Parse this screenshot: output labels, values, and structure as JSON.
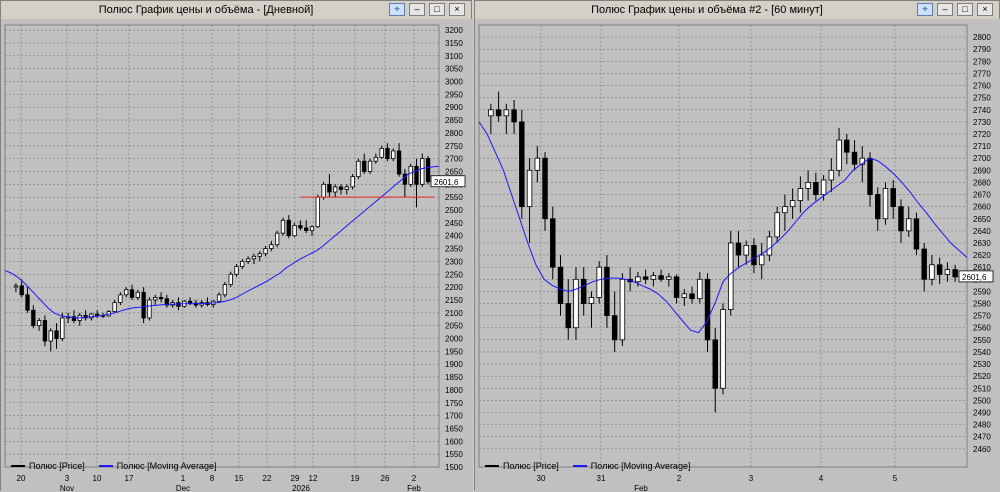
{
  "windows": [
    {
      "title": "Полюс График цены и объёма - [Дневной]",
      "legend": [
        {
          "label": "Полюс [Price]",
          "color": "#000000"
        },
        {
          "label": "Полюс [Moving Average]",
          "color": "#1a1aff"
        }
      ],
      "price_label": "2601,6"
    },
    {
      "title": "Полюс График цены и объёма #2 - [60 минут]",
      "legend": [
        {
          "label": "Полюс [Price]",
          "color": "#000000"
        },
        {
          "label": "Полюс [Moving Average]",
          "color": "#1a1aff"
        }
      ],
      "price_label": "2601,6"
    }
  ],
  "chart_data": [
    {
      "type": "candlestick",
      "title": "Полюс График цены и объёма - [Дневной]",
      "ylim": [
        1500,
        3220
      ],
      "y_ticks": [
        1500,
        1550,
        1600,
        1650,
        1700,
        1750,
        1800,
        1850,
        1900,
        1950,
        2000,
        2050,
        2100,
        2150,
        2200,
        2250,
        2300,
        2350,
        2400,
        2450,
        2500,
        2550,
        2600,
        2650,
        2700,
        2750,
        2800,
        2850,
        2900,
        2950,
        3000,
        3050,
        3100,
        3150,
        3200
      ],
      "x_day_labels": [
        "20",
        "3",
        "10",
        "17",
        "1",
        "8",
        "15",
        "22",
        "29",
        "12",
        "19",
        "26",
        "2"
      ],
      "x_month_labels": [
        "Nov",
        "Dec",
        "2026",
        "Feb"
      ],
      "candles": [
        {
          "o": 2200,
          "h": 2215,
          "l": 2180,
          "c": 2205
        },
        {
          "o": 2205,
          "h": 2230,
          "l": 2160,
          "c": 2170
        },
        {
          "o": 2170,
          "h": 2200,
          "l": 2100,
          "c": 2110
        },
        {
          "o": 2110,
          "h": 2130,
          "l": 2040,
          "c": 2050
        },
        {
          "o": 2050,
          "h": 2080,
          "l": 2030,
          "c": 2070
        },
        {
          "o": 2070,
          "h": 2090,
          "l": 1970,
          "c": 1990
        },
        {
          "o": 1990,
          "h": 2040,
          "l": 1950,
          "c": 2030
        },
        {
          "o": 2030,
          "h": 2060,
          "l": 1960,
          "c": 2000
        },
        {
          "o": 2000,
          "h": 2100,
          "l": 1990,
          "c": 2080
        },
        {
          "o": 2080,
          "h": 2100,
          "l": 2060,
          "c": 2085
        },
        {
          "o": 2085,
          "h": 2110,
          "l": 2060,
          "c": 2070
        },
        {
          "o": 2070,
          "h": 2100,
          "l": 2050,
          "c": 2090
        },
        {
          "o": 2090,
          "h": 2110,
          "l": 2070,
          "c": 2080
        },
        {
          "o": 2080,
          "h": 2100,
          "l": 2070,
          "c": 2095
        },
        {
          "o": 2095,
          "h": 2110,
          "l": 2080,
          "c": 2090
        },
        {
          "o": 2090,
          "h": 2100,
          "l": 2080,
          "c": 2088
        },
        {
          "o": 2088,
          "h": 2110,
          "l": 2085,
          "c": 2105
        },
        {
          "o": 2105,
          "h": 2150,
          "l": 2100,
          "c": 2140
        },
        {
          "o": 2140,
          "h": 2180,
          "l": 2130,
          "c": 2170
        },
        {
          "o": 2170,
          "h": 2200,
          "l": 2160,
          "c": 2190
        },
        {
          "o": 2190,
          "h": 2210,
          "l": 2150,
          "c": 2160
        },
        {
          "o": 2160,
          "h": 2190,
          "l": 2150,
          "c": 2180
        },
        {
          "o": 2180,
          "h": 2200,
          "l": 2060,
          "c": 2080
        },
        {
          "o": 2080,
          "h": 2160,
          "l": 2070,
          "c": 2150
        },
        {
          "o": 2150,
          "h": 2170,
          "l": 2130,
          "c": 2160
        },
        {
          "o": 2160,
          "h": 2180,
          "l": 2140,
          "c": 2155
        },
        {
          "o": 2155,
          "h": 2170,
          "l": 2120,
          "c": 2130
        },
        {
          "o": 2130,
          "h": 2150,
          "l": 2120,
          "c": 2140
        },
        {
          "o": 2140,
          "h": 2160,
          "l": 2110,
          "c": 2125
        },
        {
          "o": 2125,
          "h": 2150,
          "l": 2120,
          "c": 2145
        },
        {
          "o": 2145,
          "h": 2160,
          "l": 2130,
          "c": 2138
        },
        {
          "o": 2138,
          "h": 2150,
          "l": 2120,
          "c": 2130
        },
        {
          "o": 2130,
          "h": 2150,
          "l": 2120,
          "c": 2140
        },
        {
          "o": 2140,
          "h": 2160,
          "l": 2125,
          "c": 2132
        },
        {
          "o": 2132,
          "h": 2150,
          "l": 2120,
          "c": 2145
        },
        {
          "o": 2145,
          "h": 2180,
          "l": 2140,
          "c": 2170
        },
        {
          "o": 2170,
          "h": 2220,
          "l": 2160,
          "c": 2210
        },
        {
          "o": 2210,
          "h": 2260,
          "l": 2200,
          "c": 2250
        },
        {
          "o": 2250,
          "h": 2290,
          "l": 2240,
          "c": 2280
        },
        {
          "o": 2280,
          "h": 2310,
          "l": 2270,
          "c": 2300
        },
        {
          "o": 2300,
          "h": 2320,
          "l": 2290,
          "c": 2310
        },
        {
          "o": 2310,
          "h": 2330,
          "l": 2290,
          "c": 2320
        },
        {
          "o": 2320,
          "h": 2340,
          "l": 2300,
          "c": 2330
        },
        {
          "o": 2330,
          "h": 2360,
          "l": 2320,
          "c": 2350
        },
        {
          "o": 2350,
          "h": 2380,
          "l": 2340,
          "c": 2365
        },
        {
          "o": 2365,
          "h": 2420,
          "l": 2355,
          "c": 2410
        },
        {
          "o": 2410,
          "h": 2470,
          "l": 2400,
          "c": 2460
        },
        {
          "o": 2460,
          "h": 2480,
          "l": 2390,
          "c": 2400
        },
        {
          "o": 2400,
          "h": 2450,
          "l": 2395,
          "c": 2440
        },
        {
          "o": 2440,
          "h": 2460,
          "l": 2420,
          "c": 2430
        },
        {
          "o": 2430,
          "h": 2460,
          "l": 2410,
          "c": 2420
        },
        {
          "o": 2420,
          "h": 2440,
          "l": 2400,
          "c": 2435
        },
        {
          "o": 2435,
          "h": 2560,
          "l": 2430,
          "c": 2550
        },
        {
          "o": 2550,
          "h": 2610,
          "l": 2540,
          "c": 2600
        },
        {
          "o": 2600,
          "h": 2640,
          "l": 2550,
          "c": 2570
        },
        {
          "o": 2570,
          "h": 2600,
          "l": 2550,
          "c": 2590
        },
        {
          "o": 2590,
          "h": 2600,
          "l": 2560,
          "c": 2580
        },
        {
          "o": 2580,
          "h": 2600,
          "l": 2560,
          "c": 2590
        },
        {
          "o": 2590,
          "h": 2640,
          "l": 2580,
          "c": 2630
        },
        {
          "o": 2630,
          "h": 2700,
          "l": 2620,
          "c": 2690
        },
        {
          "o": 2690,
          "h": 2720,
          "l": 2640,
          "c": 2650
        },
        {
          "o": 2650,
          "h": 2700,
          "l": 2640,
          "c": 2690
        },
        {
          "o": 2690,
          "h": 2720,
          "l": 2680,
          "c": 2705
        },
        {
          "o": 2705,
          "h": 2750,
          "l": 2700,
          "c": 2740
        },
        {
          "o": 2740,
          "h": 2760,
          "l": 2690,
          "c": 2700
        },
        {
          "o": 2700,
          "h": 2740,
          "l": 2690,
          "c": 2730
        },
        {
          "o": 2730,
          "h": 2760,
          "l": 2630,
          "c": 2640
        },
        {
          "o": 2640,
          "h": 2660,
          "l": 2550,
          "c": 2600
        },
        {
          "o": 2600,
          "h": 2680,
          "l": 2590,
          "c": 2670
        },
        {
          "o": 2670,
          "h": 2700,
          "l": 2510,
          "c": 2600
        },
        {
          "o": 2600,
          "h": 2720,
          "l": 2590,
          "c": 2700
        },
        {
          "o": 2700,
          "h": 2710,
          "l": 2600,
          "c": 2610
        }
      ],
      "moving_average": [
        2265,
        2255,
        2240,
        2220,
        2195,
        2170,
        2145,
        2120,
        2100,
        2090,
        2085,
        2082,
        2080,
        2082,
        2085,
        2087,
        2090,
        2095,
        2100,
        2108,
        2115,
        2120,
        2122,
        2125,
        2128,
        2130,
        2132,
        2133,
        2134,
        2135,
        2135,
        2136,
        2136,
        2137,
        2138,
        2140,
        2145,
        2152,
        2162,
        2175,
        2188,
        2200,
        2212,
        2225,
        2240,
        2255,
        2275,
        2290,
        2305,
        2318,
        2330,
        2342,
        2360,
        2380,
        2400,
        2420,
        2440,
        2460,
        2480,
        2500,
        2520,
        2540,
        2560,
        2580,
        2600,
        2620,
        2640,
        2650,
        2660,
        2665,
        2668,
        2670
      ],
      "hline": {
        "value": 2550,
        "color": "#e02020",
        "from_index": 49,
        "to_index": 71
      }
    },
    {
      "type": "candlestick",
      "title": "Полюс График цены и объёма #2 - [60 минут]",
      "ylim": [
        2445,
        2810
      ],
      "y_ticks": [
        2460,
        2470,
        2480,
        2490,
        2500,
        2510,
        2520,
        2530,
        2540,
        2550,
        2560,
        2570,
        2580,
        2590,
        2600,
        2610,
        2620,
        2630,
        2640,
        2650,
        2660,
        2670,
        2680,
        2690,
        2700,
        2710,
        2720,
        2730,
        2740,
        2750,
        2760,
        2770,
        2780,
        2790,
        2800
      ],
      "x_day_labels": [
        "30",
        "31",
        "2",
        "3",
        "4",
        "5"
      ],
      "x_month_labels": [
        "Feb"
      ],
      "candles": [
        {
          "o": 2735,
          "h": 2745,
          "l": 2720,
          "c": 2740
        },
        {
          "o": 2740,
          "h": 2755,
          "l": 2730,
          "c": 2735
        },
        {
          "o": 2735,
          "h": 2745,
          "l": 2720,
          "c": 2740
        },
        {
          "o": 2740,
          "h": 2748,
          "l": 2720,
          "c": 2730
        },
        {
          "o": 2730,
          "h": 2740,
          "l": 2650,
          "c": 2660
        },
        {
          "o": 2660,
          "h": 2700,
          "l": 2630,
          "c": 2690
        },
        {
          "o": 2690,
          "h": 2710,
          "l": 2680,
          "c": 2700
        },
        {
          "o": 2700,
          "h": 2705,
          "l": 2640,
          "c": 2650
        },
        {
          "o": 2650,
          "h": 2660,
          "l": 2600,
          "c": 2610
        },
        {
          "o": 2610,
          "h": 2620,
          "l": 2570,
          "c": 2580
        },
        {
          "o": 2580,
          "h": 2600,
          "l": 2550,
          "c": 2560
        },
        {
          "o": 2560,
          "h": 2610,
          "l": 2550,
          "c": 2600
        },
        {
          "o": 2600,
          "h": 2610,
          "l": 2570,
          "c": 2580
        },
        {
          "o": 2580,
          "h": 2590,
          "l": 2560,
          "c": 2585
        },
        {
          "o": 2585,
          "h": 2615,
          "l": 2580,
          "c": 2610
        },
        {
          "o": 2610,
          "h": 2620,
          "l": 2560,
          "c": 2570
        },
        {
          "o": 2570,
          "h": 2590,
          "l": 2540,
          "c": 2550
        },
        {
          "o": 2550,
          "h": 2605,
          "l": 2545,
          "c": 2600
        },
        {
          "o": 2600,
          "h": 2610,
          "l": 2590,
          "c": 2598
        },
        {
          "o": 2598,
          "h": 2606,
          "l": 2594,
          "c": 2602
        },
        {
          "o": 2602,
          "h": 2608,
          "l": 2596,
          "c": 2600
        },
        {
          "o": 2600,
          "h": 2606,
          "l": 2594,
          "c": 2603
        },
        {
          "o": 2603,
          "h": 2608,
          "l": 2598,
          "c": 2600
        },
        {
          "o": 2600,
          "h": 2605,
          "l": 2594,
          "c": 2602
        },
        {
          "o": 2602,
          "h": 2604,
          "l": 2580,
          "c": 2585
        },
        {
          "o": 2585,
          "h": 2592,
          "l": 2578,
          "c": 2588
        },
        {
          "o": 2588,
          "h": 2594,
          "l": 2580,
          "c": 2584
        },
        {
          "o": 2584,
          "h": 2606,
          "l": 2580,
          "c": 2600
        },
        {
          "o": 2600,
          "h": 2605,
          "l": 2540,
          "c": 2550
        },
        {
          "o": 2550,
          "h": 2560,
          "l": 2490,
          "c": 2510
        },
        {
          "o": 2510,
          "h": 2580,
          "l": 2505,
          "c": 2575
        },
        {
          "o": 2575,
          "h": 2640,
          "l": 2570,
          "c": 2630
        },
        {
          "o": 2630,
          "h": 2640,
          "l": 2610,
          "c": 2620
        },
        {
          "o": 2620,
          "h": 2632,
          "l": 2612,
          "c": 2628
        },
        {
          "o": 2628,
          "h": 2634,
          "l": 2605,
          "c": 2612
        },
        {
          "o": 2612,
          "h": 2630,
          "l": 2600,
          "c": 2620
        },
        {
          "o": 2620,
          "h": 2640,
          "l": 2615,
          "c": 2635
        },
        {
          "o": 2635,
          "h": 2660,
          "l": 2630,
          "c": 2655
        },
        {
          "o": 2655,
          "h": 2670,
          "l": 2640,
          "c": 2660
        },
        {
          "o": 2660,
          "h": 2675,
          "l": 2650,
          "c": 2665
        },
        {
          "o": 2665,
          "h": 2685,
          "l": 2655,
          "c": 2675
        },
        {
          "o": 2675,
          "h": 2690,
          "l": 2665,
          "c": 2680
        },
        {
          "o": 2680,
          "h": 2688,
          "l": 2665,
          "c": 2670
        },
        {
          "o": 2670,
          "h": 2686,
          "l": 2665,
          "c": 2682
        },
        {
          "o": 2682,
          "h": 2700,
          "l": 2672,
          "c": 2690
        },
        {
          "o": 2690,
          "h": 2725,
          "l": 2685,
          "c": 2715
        },
        {
          "o": 2715,
          "h": 2720,
          "l": 2695,
          "c": 2705
        },
        {
          "o": 2705,
          "h": 2715,
          "l": 2690,
          "c": 2695
        },
        {
          "o": 2695,
          "h": 2710,
          "l": 2680,
          "c": 2700
        },
        {
          "o": 2700,
          "h": 2705,
          "l": 2660,
          "c": 2670
        },
        {
          "o": 2670,
          "h": 2676,
          "l": 2640,
          "c": 2650
        },
        {
          "o": 2650,
          "h": 2680,
          "l": 2645,
          "c": 2675
        },
        {
          "o": 2675,
          "h": 2682,
          "l": 2650,
          "c": 2660
        },
        {
          "o": 2660,
          "h": 2666,
          "l": 2630,
          "c": 2640
        },
        {
          "o": 2640,
          "h": 2660,
          "l": 2635,
          "c": 2650
        },
        {
          "o": 2650,
          "h": 2655,
          "l": 2620,
          "c": 2625
        },
        {
          "o": 2625,
          "h": 2630,
          "l": 2590,
          "c": 2600
        },
        {
          "o": 2600,
          "h": 2620,
          "l": 2595,
          "c": 2612
        },
        {
          "o": 2612,
          "h": 2618,
          "l": 2596,
          "c": 2604
        },
        {
          "o": 2604,
          "h": 2614,
          "l": 2598,
          "c": 2608
        },
        {
          "o": 2608,
          "h": 2612,
          "l": 2598,
          "c": 2602
        }
      ],
      "moving_average": [
        2730,
        2720,
        2705,
        2690,
        2670,
        2650,
        2630,
        2612,
        2600,
        2595,
        2592,
        2590,
        2592,
        2595,
        2598,
        2600,
        2601,
        2601,
        2600,
        2598,
        2595,
        2592,
        2588,
        2582,
        2574,
        2566,
        2558,
        2556,
        2565,
        2580,
        2598,
        2605,
        2610,
        2614,
        2618,
        2622,
        2627,
        2633,
        2640,
        2648,
        2656,
        2662,
        2667,
        2672,
        2677,
        2682,
        2690,
        2695,
        2700,
        2698,
        2693,
        2687,
        2680,
        2672,
        2663,
        2655,
        2646,
        2638,
        2630,
        2624,
        2618
      ]
    }
  ]
}
